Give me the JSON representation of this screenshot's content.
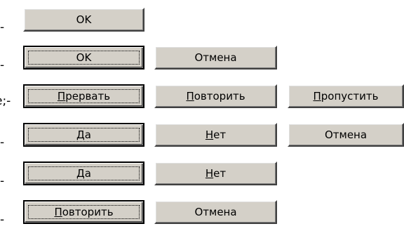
{
  "rows": [
    {
      "prefix": "-",
      "buttons": [
        {
          "label": "OK"
        }
      ]
    },
    {
      "prefix": "-",
      "buttons": [
        {
          "label": "OK"
        },
        {
          "label": "Отмена"
        }
      ]
    },
    {
      "prefix": "е;-",
      "buttons": [
        {
          "accel": "П",
          "rest": "рервать"
        },
        {
          "accel": "П",
          "rest": "овторить"
        },
        {
          "accel": "П",
          "rest": "ропустить"
        }
      ]
    },
    {
      "prefix": "-",
      "buttons": [
        {
          "accel": "Д",
          "rest": "а"
        },
        {
          "accel": "Н",
          "rest": "ет"
        },
        {
          "label": "Отмена"
        }
      ]
    },
    {
      "prefix": "-",
      "buttons": [
        {
          "accel": "Д",
          "rest": "а"
        },
        {
          "accel": "Н",
          "rest": "ет"
        }
      ]
    },
    {
      "prefix": "-",
      "buttons": [
        {
          "accel": "П",
          "rest": "овторить"
        },
        {
          "label": "Отмена"
        }
      ]
    }
  ]
}
